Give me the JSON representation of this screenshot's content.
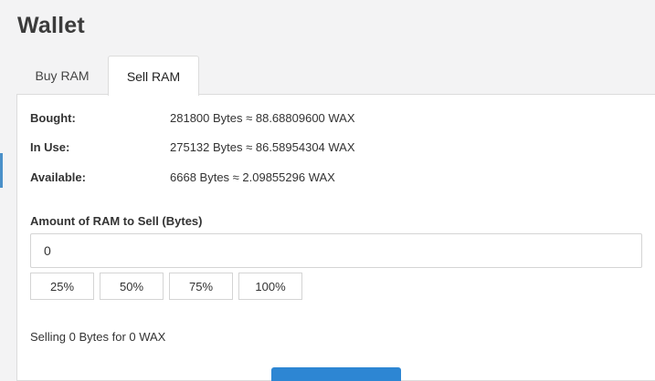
{
  "page": {
    "title": "Wallet"
  },
  "tabs": [
    {
      "label": "Buy RAM",
      "active": false
    },
    {
      "label": "Sell RAM",
      "active": true
    }
  ],
  "ram_info": [
    {
      "label": "Bought:",
      "value": "281800 Bytes ≈ 88.68809600 WAX"
    },
    {
      "label": "In Use:",
      "value": "275132 Bytes ≈ 86.58954304 WAX"
    },
    {
      "label": "Available:",
      "value": "6668 Bytes ≈ 2.09855296 WAX"
    }
  ],
  "sell_form": {
    "amount_label": "Amount of RAM to Sell (Bytes)",
    "amount_value": "0",
    "percent_buttons": [
      "25%",
      "50%",
      "75%",
      "100%"
    ],
    "summary": "Selling 0 Bytes for 0 WAX"
  },
  "colors": {
    "accent": "#2d86d3",
    "background": "#f3f3f4",
    "panel": "#ffffff",
    "border": "#dcdcdc"
  }
}
